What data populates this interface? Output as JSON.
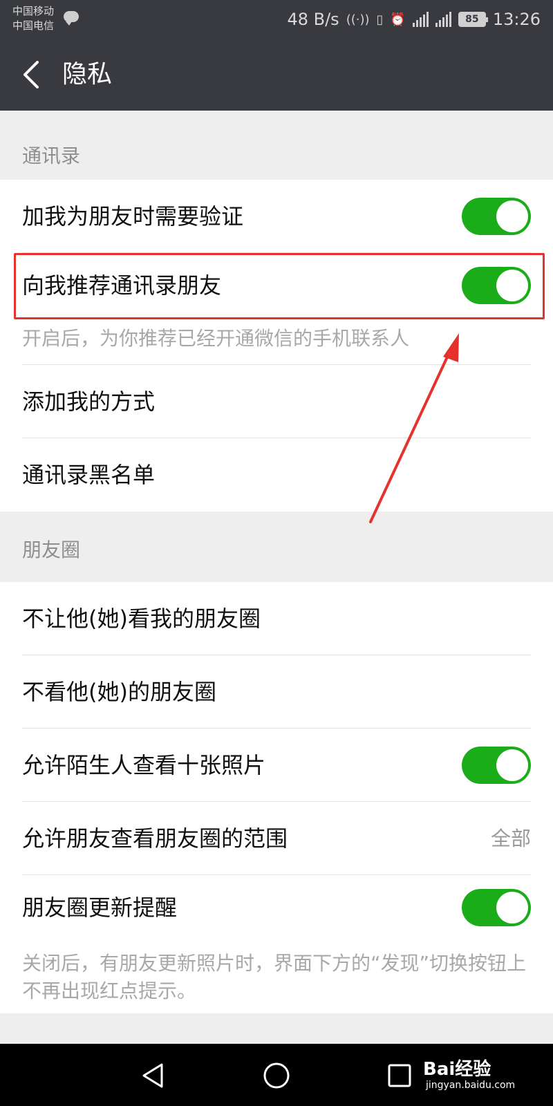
{
  "status_bar": {
    "carrier_1": "中国移动",
    "carrier_2": "中国电信",
    "net_speed": "48 B/s",
    "battery": "85",
    "time": "13:26",
    "icons": [
      "wechat-notification-icon",
      "hotspot-icon",
      "vibrate-icon",
      "alarm-icon",
      "signal-2g-icon",
      "signal-4g-icon",
      "battery-icon"
    ]
  },
  "header": {
    "title": "隐私",
    "back_icon": "chevron-left-icon"
  },
  "sections": {
    "contacts": {
      "title": "通讯录",
      "rows": {
        "verify": {
          "label": "加我为朋友时需要验证",
          "toggle_on": true
        },
        "recommend": {
          "label": "向我推荐通讯录朋友",
          "toggle_on": true
        },
        "recommend_hint": "开启后，为你推荐已经开通微信的手机联系人",
        "add_methods": {
          "label": "添加我的方式"
        },
        "blacklist": {
          "label": "通讯录黑名单"
        }
      }
    },
    "moments": {
      "title": "朋友圈",
      "rows": {
        "hide_my": {
          "label": "不让他(她)看我的朋友圈"
        },
        "hide_theirs": {
          "label": "不看他(她)的朋友圈"
        },
        "strangers": {
          "label": "允许陌生人查看十张照片",
          "toggle_on": true
        },
        "range": {
          "label": "允许朋友查看朋友圈的范围",
          "value": "全部"
        },
        "updates": {
          "label": "朋友圈更新提醒",
          "toggle_on": true
        },
        "updates_hint": "关闭后，有朋友更新照片时，界面下方的“发现”切换按钮上不再出现红点提示。"
      }
    }
  },
  "nav_bar": {
    "icons": [
      "back-triangle-icon",
      "home-circle-icon",
      "recents-square-icon"
    ]
  },
  "watermark": {
    "logo": "Bai经验",
    "url": "jingyan.baidu.com"
  },
  "colors": {
    "header_bg": "#393a3f",
    "toggle_on": "#1aad19",
    "annotation": "#e5322d",
    "page_bg": "#eeeeee"
  }
}
